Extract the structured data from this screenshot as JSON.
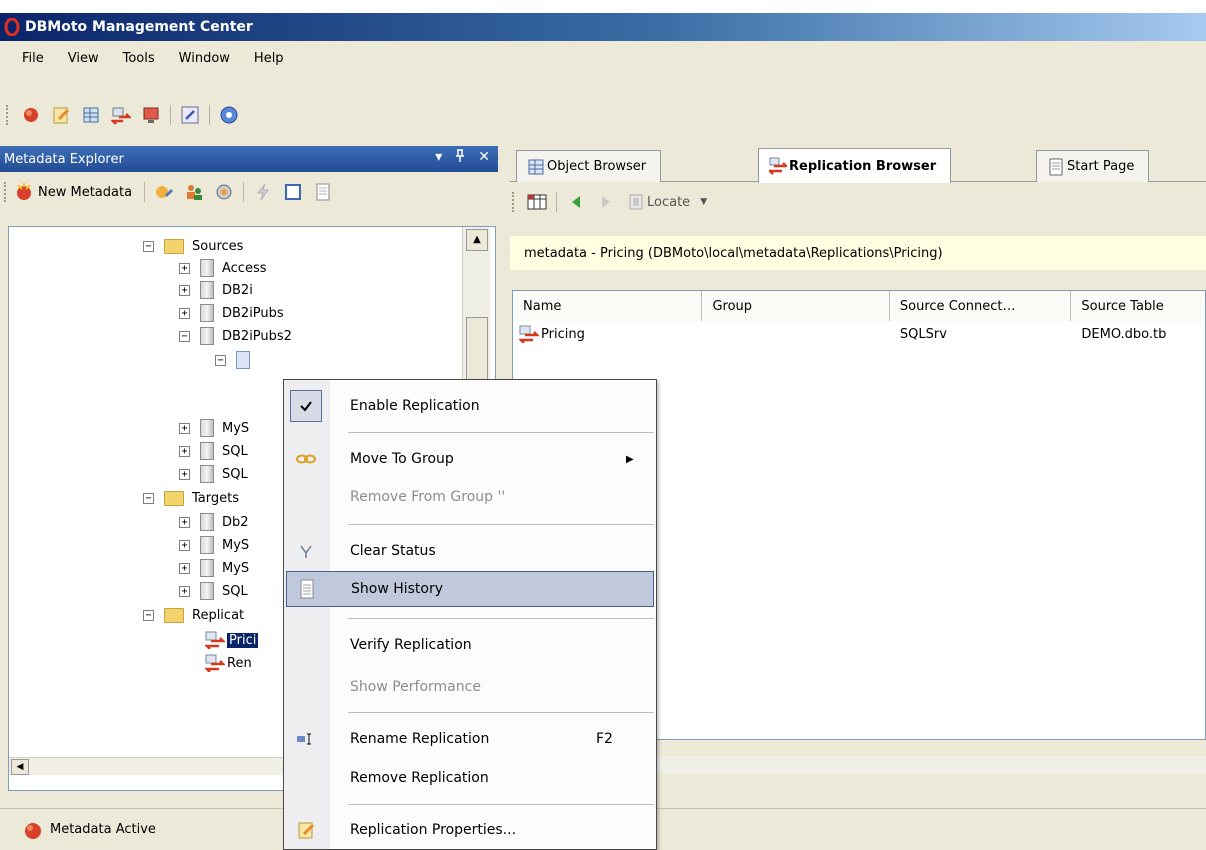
{
  "window": {
    "title": "DBMoto Management Center"
  },
  "menu": [
    "File",
    "View",
    "Tools",
    "Window",
    "Help"
  ],
  "explorer": {
    "title": "Metadata Explorer",
    "header_buttons": [
      "▾",
      "ꟷ",
      "✕"
    ],
    "new_metadata": "New Metadata",
    "tree": {
      "sources": "Sources",
      "access": "Access",
      "db2i": "DB2i",
      "db2ipubs": "DB2iPubs",
      "db2ipubs2": "DB2iPubs2",
      "mys": "MyS",
      "sql1": "SQL",
      "sql2": "SQL",
      "targets": "Targets",
      "db2": "Db2",
      "mys_t1": "MyS",
      "mys_t2": "MyS",
      "sql_t": "SQL",
      "replications": "Replicat",
      "pricing": "Prici",
      "ren": "Ren"
    },
    "plus": "+",
    "minus": "−"
  },
  "tabs": [
    {
      "label": "Object Browser",
      "active": false
    },
    {
      "label": "Replication Browser",
      "active": true
    },
    {
      "label": "Start Page",
      "active": false
    }
  ],
  "browser_toolbar": {
    "locate": "Locate"
  },
  "path": "metadata - Pricing (DBMoto\\local\\metadata\\Replications\\Pricing)",
  "grid": {
    "columns": [
      "Name",
      "Group",
      "Source Connect…",
      "Source Table"
    ],
    "rows": [
      {
        "name": "Pricing",
        "group": "",
        "source_connection": "SQLSrv",
        "source_table": "DEMO.dbo.tb"
      }
    ]
  },
  "status": "Metadata Active",
  "context_menu": {
    "enable_replication": "Enable Replication",
    "move_to_group": "Move To Group",
    "remove_from_group": "Remove From Group ''",
    "clear_status": "Clear Status",
    "show_history": "Show History",
    "verify_replication": "Verify Replication",
    "show_performance": "Show Performance",
    "rename_replication": "Rename Replication",
    "rename_shortcut": "F2",
    "remove_replication": "Remove Replication",
    "replication_properties": "Replication Properties..."
  },
  "colors": {
    "title_bar": "#0a246a",
    "panel_header": "#2f5ea8",
    "selection": "#0a246a",
    "menu_hover": "#c0c8dc",
    "path_bar": "#ffffe1"
  }
}
